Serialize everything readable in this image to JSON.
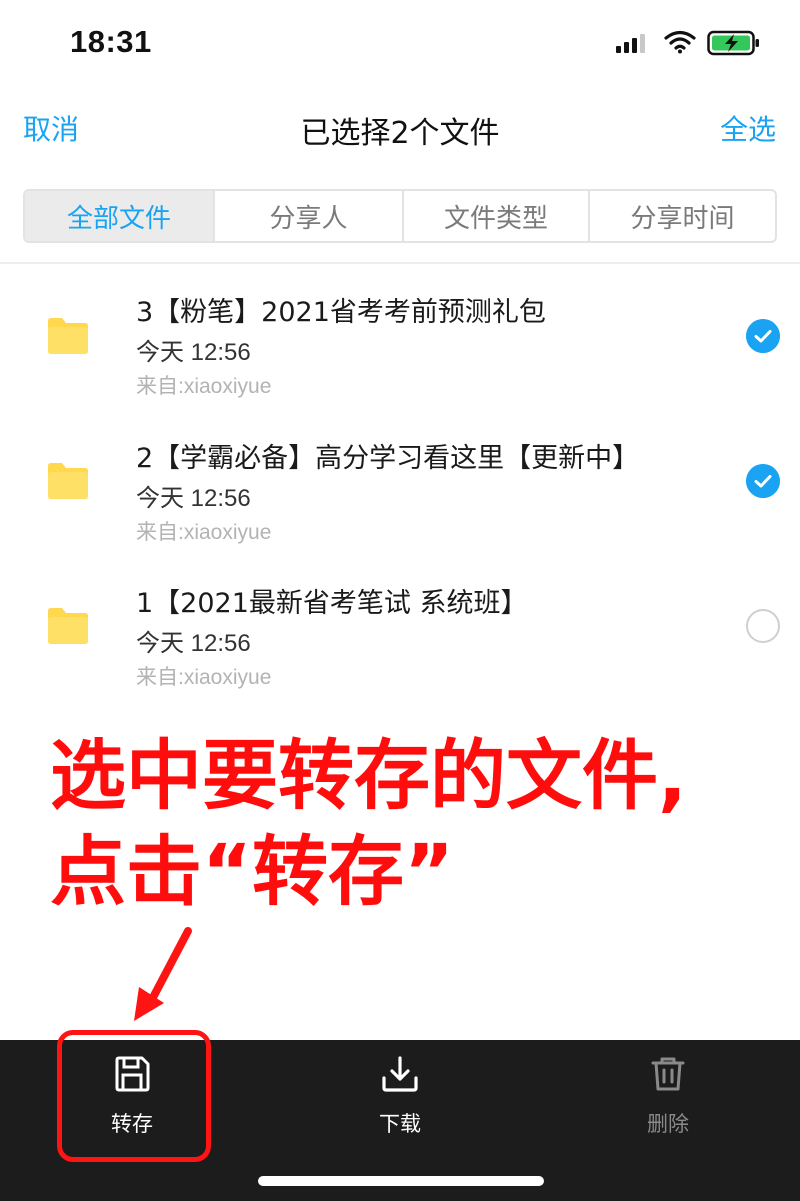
{
  "status_bar": {
    "time": "18:31"
  },
  "nav": {
    "cancel": "取消",
    "title": "已选择2个文件",
    "select_all": "全选"
  },
  "tabs": [
    {
      "label": "全部文件",
      "active": true
    },
    {
      "label": "分享人",
      "active": false
    },
    {
      "label": "文件类型",
      "active": false
    },
    {
      "label": "分享时间",
      "active": false
    }
  ],
  "files": [
    {
      "name": "3【粉笔】2021省考考前预测礼包",
      "time": "今天 12:56",
      "source": "来自:xiaoxiyue",
      "selected": true
    },
    {
      "name": "2【学霸必备】高分学习看这里【更新中】",
      "time": "今天 12:56",
      "source": "来自:xiaoxiyue",
      "selected": true
    },
    {
      "name": "1【2021最新省考笔试 系统班】",
      "time": "今天 12:56",
      "source": "来自:xiaoxiyue",
      "selected": false
    }
  ],
  "annotation": {
    "line1": "选中要转存的文件,",
    "line2": "点击“转存”"
  },
  "toolbar": {
    "save": "转存",
    "download": "下载",
    "delete": "删除"
  },
  "colors": {
    "accent": "#1aa3f2",
    "folder": "#ffd84d",
    "annotation": "#ff0d0d",
    "toolbar_bg": "#1c1c1c"
  }
}
